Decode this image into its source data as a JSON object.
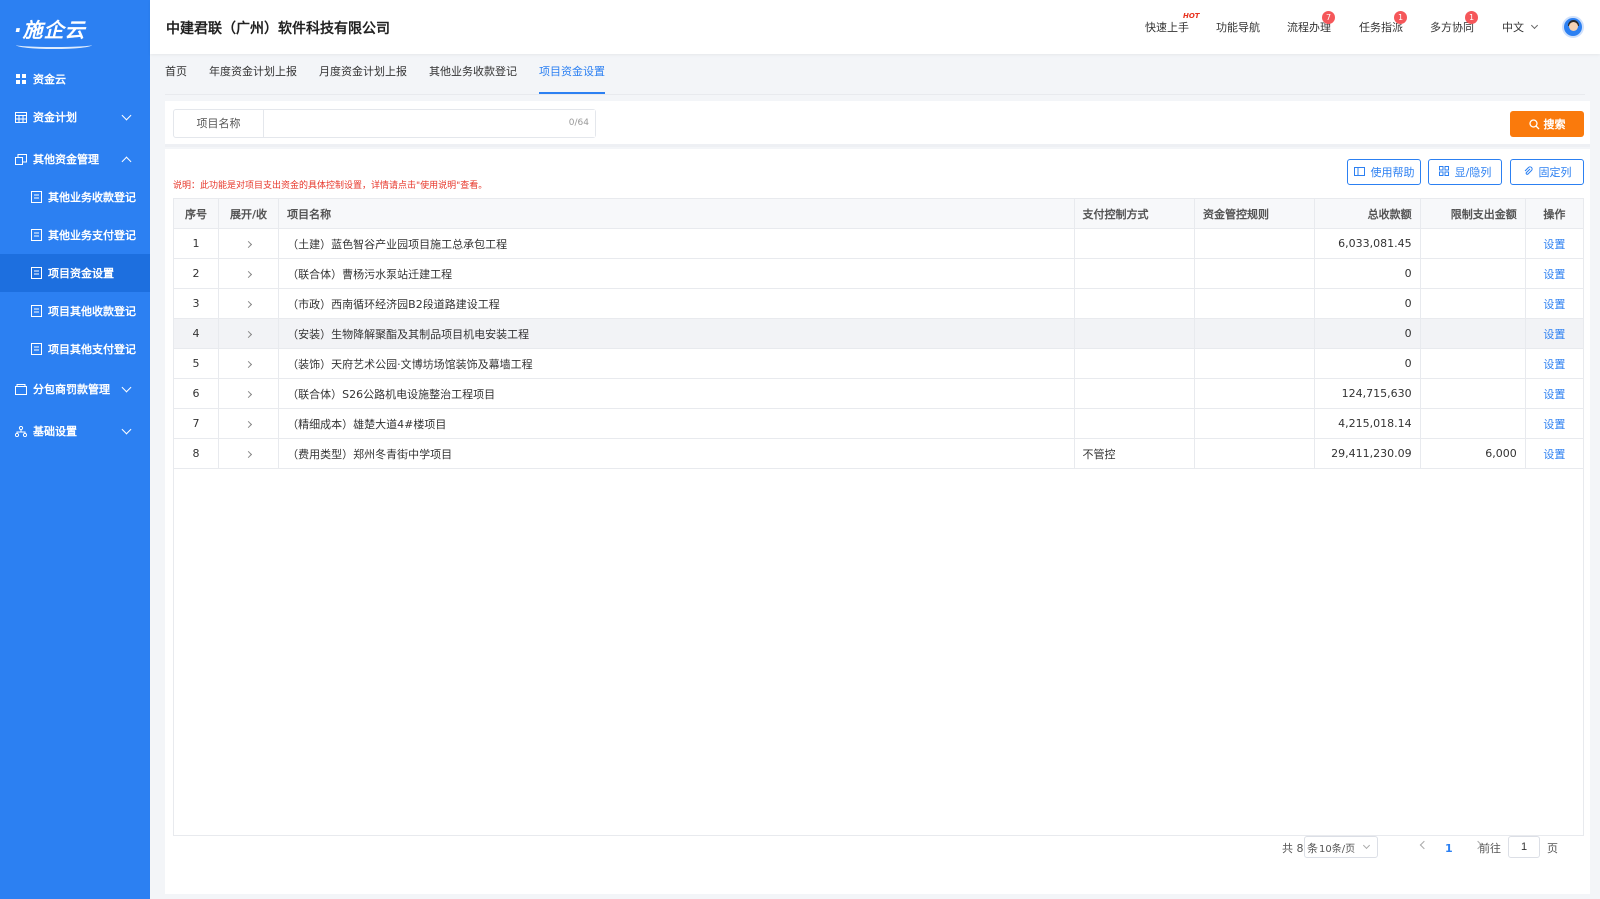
{
  "app": {
    "logo": "·施企云",
    "company": "中建君联（广州）软件科技有限公司"
  },
  "sidebar": {
    "items": [
      {
        "label": "资金云",
        "icon": "grid-icon"
      },
      {
        "label": "资金计划",
        "icon": "calendar-icon"
      },
      {
        "label": "其他资金管理",
        "icon": "stack-icon"
      },
      {
        "label": "其他业务收款登记",
        "icon": "receipt-icon"
      },
      {
        "label": "其他业务支付登记",
        "icon": "receipt-icon"
      },
      {
        "label": "项目资金设置",
        "icon": "receipt-icon"
      },
      {
        "label": "项目其他收款登记",
        "icon": "receipt-icon"
      },
      {
        "label": "项目其他支付登记",
        "icon": "receipt-icon"
      },
      {
        "label": "分包商罚款管理",
        "icon": "wallet-icon"
      },
      {
        "label": "基础设置",
        "icon": "network-icon"
      }
    ]
  },
  "header": {
    "nav": [
      {
        "label": "快速上手",
        "hot": "HOT"
      },
      {
        "label": "功能导航"
      },
      {
        "label": "流程办理",
        "badge": "7"
      },
      {
        "label": "任务指派",
        "badge": "1"
      },
      {
        "label": "多方协同",
        "badge": "1"
      }
    ],
    "language": "中文"
  },
  "tabs": [
    "首页",
    "年度资金计划上报",
    "月度资金计划上报",
    "其他业务收款登记",
    "项目资金设置"
  ],
  "search": {
    "label": "项目名称",
    "value": "",
    "count": "0/64",
    "button": "搜索"
  },
  "toolbar": {
    "note": "说明：此功能是对项目支出资金的具体控制设置，详情请点击\"使用说明\"查看。",
    "help": "使用帮助",
    "toggle_cols": "显/隐列",
    "fix_cols": "固定列"
  },
  "table": {
    "headers": [
      "序号",
      "展开/收",
      "项目名称",
      "支付控制方式",
      "资金管控规则",
      "总收款额",
      "限制支出金额",
      "操作"
    ],
    "rows": [
      {
        "no": "1",
        "name": "（土建）蓝色智谷产业园项目施工总承包工程",
        "pay": "",
        "rule": "",
        "total": "6,033,081.45",
        "limit": "",
        "action": "设置"
      },
      {
        "no": "2",
        "name": "（联合体）曹杨污水泵站迁建工程",
        "pay": "",
        "rule": "",
        "total": "0",
        "limit": "",
        "action": "设置"
      },
      {
        "no": "3",
        "name": "（市政）西南循环经济园B2段道路建设工程",
        "pay": "",
        "rule": "",
        "total": "0",
        "limit": "",
        "action": "设置"
      },
      {
        "no": "4",
        "name": "（安装）生物降解聚酯及其制品项目机电安装工程",
        "pay": "",
        "rule": "",
        "total": "0",
        "limit": "",
        "action": "设置"
      },
      {
        "no": "5",
        "name": "（装饰）天府艺术公园·文博坊场馆装饰及幕墙工程",
        "pay": "",
        "rule": "",
        "total": "0",
        "limit": "",
        "action": "设置"
      },
      {
        "no": "6",
        "name": "（联合体）S26公路机电设施整治工程项目",
        "pay": "",
        "rule": "",
        "total": "124,715,630",
        "limit": "",
        "action": "设置"
      },
      {
        "no": "7",
        "name": "（精细成本）雄楚大道4#楼项目",
        "pay": "",
        "rule": "",
        "total": "4,215,018.14",
        "limit": "",
        "action": "设置"
      },
      {
        "no": "8",
        "name": "（费用类型）郑州冬青街中学项目",
        "pay": "不管控",
        "rule": "",
        "total": "29,411,230.09",
        "limit": "6,000",
        "action": "设置"
      }
    ]
  },
  "pagination": {
    "total": "共 8 条",
    "page_size": "10条/页",
    "current": "1",
    "goto_label": "前往",
    "goto_value": "1",
    "page_suffix": "页"
  }
}
